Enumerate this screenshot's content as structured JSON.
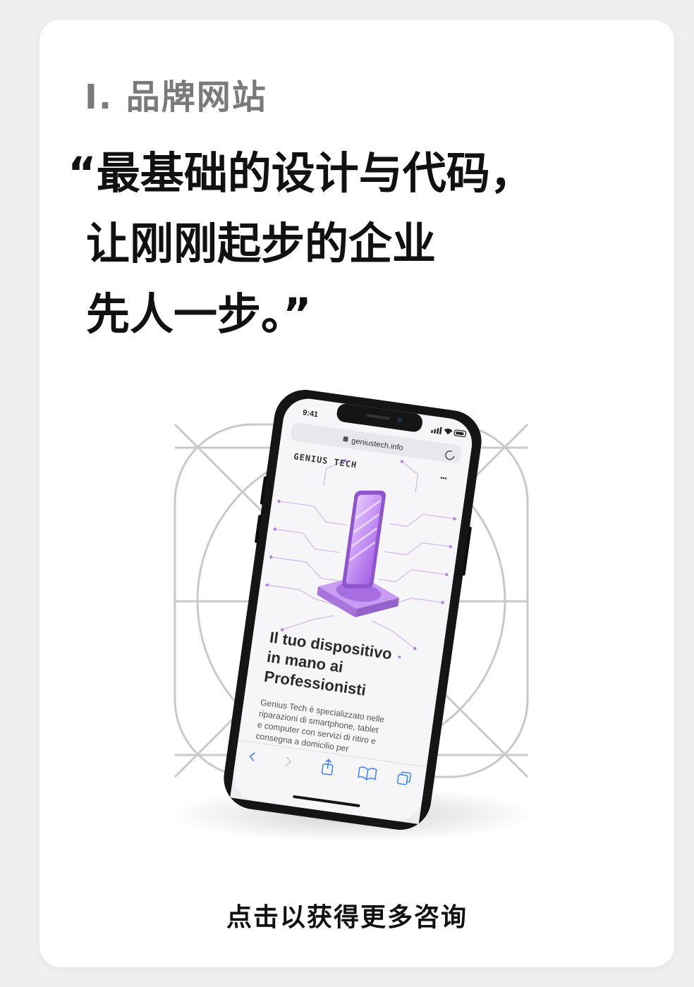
{
  "section": {
    "title": "I. 品牌网站"
  },
  "quote": {
    "line1": "“最基础的设计与代码，",
    "line2": "让刚刚起步的企业",
    "line3": "先人一步。”"
  },
  "phone": {
    "status_time": "9:41",
    "url": "geniustech.info",
    "brand": "GENIUS TECH",
    "headline_line1": "Il tuo dispositivo",
    "headline_line2": "in mano ai",
    "headline_line3": "Professionisti",
    "body_line1": "Genius Tech è specializzato nelle",
    "body_line2": "riparazioni di smartphone, tablet",
    "body_line3": "e computer con servizi di  ritiro e",
    "body_line4": "consegna a domicilio per",
    "menu_dots": "•••",
    "accent_color": "#b77ee8"
  },
  "cta": {
    "label": "点击以获得更多咨询"
  }
}
